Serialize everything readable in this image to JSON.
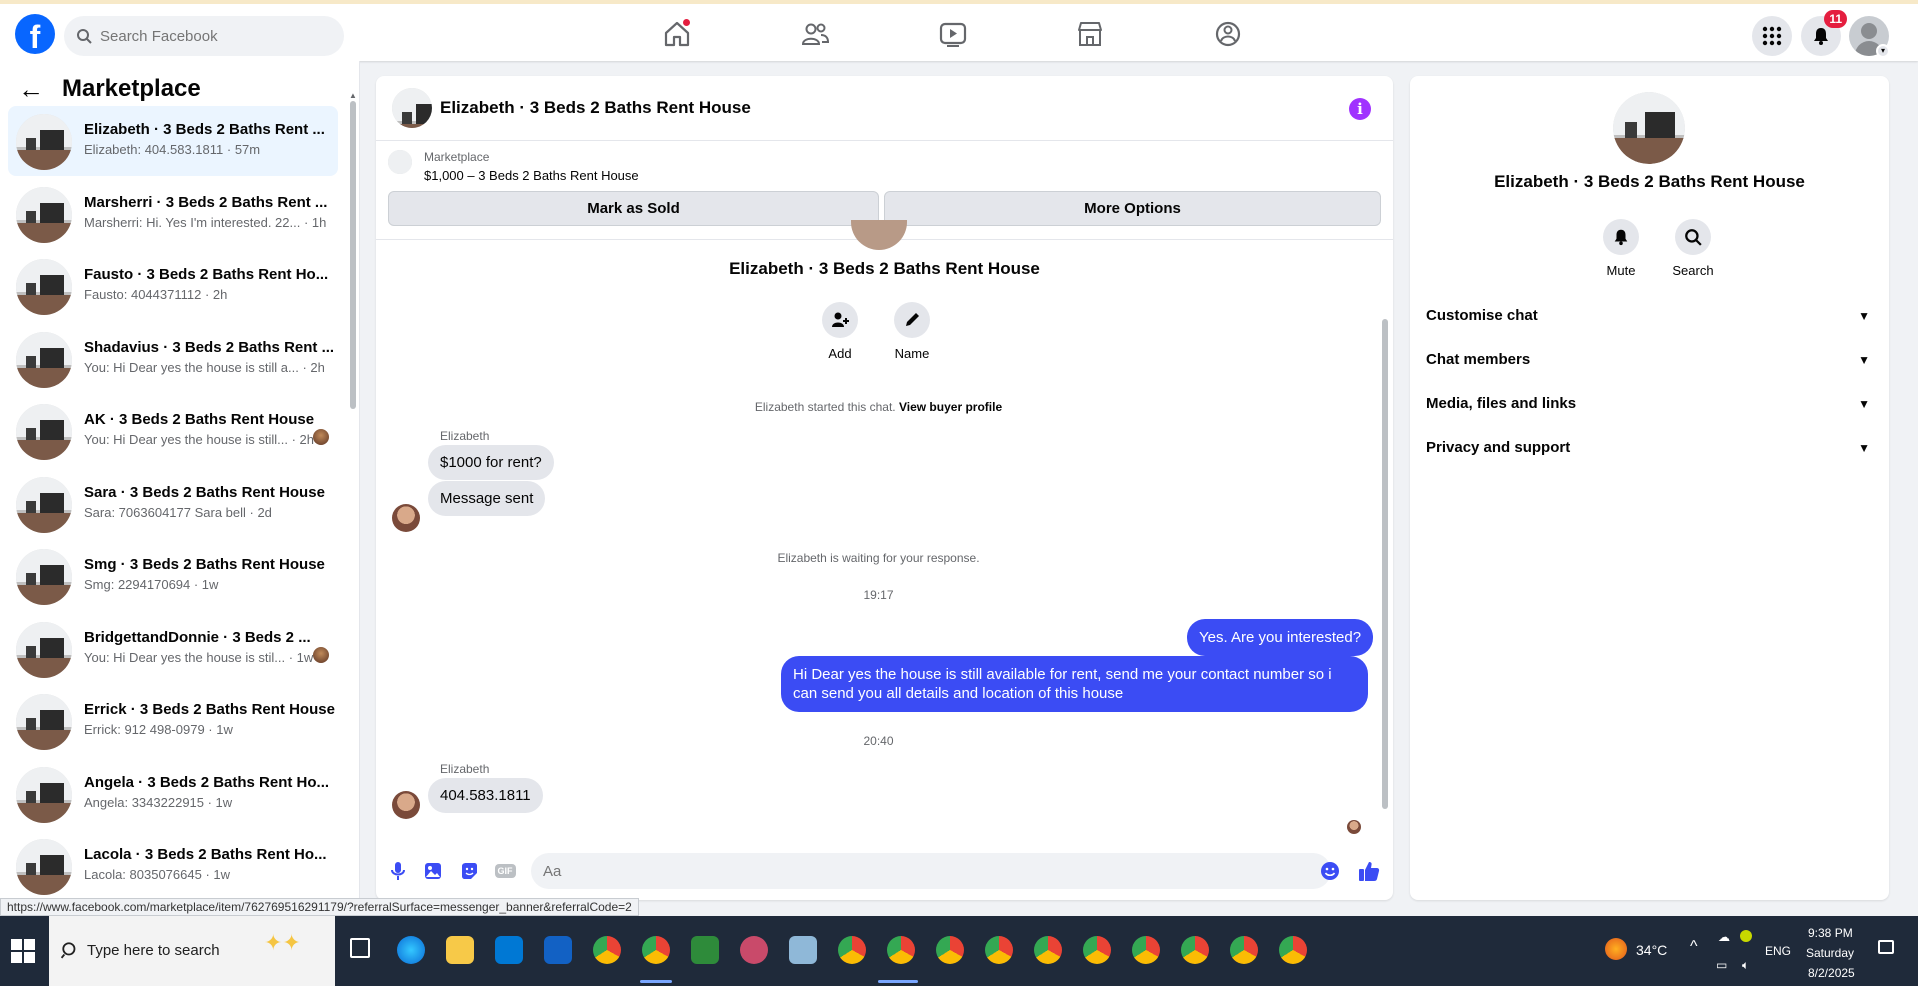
{
  "topbar": {
    "search_placeholder": "Search Facebook",
    "notif_count": "11",
    "logo_letter": "f"
  },
  "sidebar": {
    "title": "Marketplace",
    "conversations": [
      {
        "title": "Elizabeth · 3 Beds 2 Baths Rent ...",
        "preview": "Elizabeth: 404.583.1811 · 57m"
      },
      {
        "title": "Marsherri · 3 Beds 2 Baths Rent ...",
        "preview": "Marsherri: Hi. Yes I'm interested. 22... · 1h"
      },
      {
        "title": "Fausto · 3 Beds 2 Baths Rent Ho...",
        "preview": "Fausto: 4044371112 · 2h"
      },
      {
        "title": "Shadavius · 3 Beds 2 Baths Rent ...",
        "preview": "You: Hi Dear yes the house is still a... · 2h"
      },
      {
        "title": "AK · 3 Beds 2 Baths Rent House",
        "preview": "You: Hi Dear yes the house is still... · 2h"
      },
      {
        "title": "Sara · 3 Beds 2 Baths Rent House",
        "preview": "Sara: 7063604177 Sara bell · 2d"
      },
      {
        "title": "Smg · 3 Beds 2 Baths Rent House",
        "preview": "Smg: 2294170694 · 1w"
      },
      {
        "title": "BridgettandDonnie · 3 Beds 2 ...",
        "preview": "You: Hi Dear yes the house is stil... · 1w"
      },
      {
        "title": "Errick · 3 Beds 2 Baths Rent House",
        "preview": "Errick: 912 498-0979 · 1w"
      },
      {
        "title": "Angela · 3 Beds 2 Baths Rent Ho...",
        "preview": "Angela: 3343222915 · 1w"
      },
      {
        "title": "Lacola · 3 Beds 2 Baths Rent Ho...",
        "preview": "Lacola: 8035076645 · 1w"
      }
    ]
  },
  "chat": {
    "title": "Elizabeth · 3 Beds 2 Baths Rent House",
    "banner_label": "Marketplace",
    "banner_item": "$1,000 – 3 Beds 2 Baths Rent House",
    "mark_sold": "Mark as Sold",
    "more_options": "More Options",
    "chat_name": "Elizabeth · 3 Beds 2 Baths Rent House",
    "add_label": "Add",
    "name_label": "Name",
    "started_text": "Elizabeth started this chat.",
    "view_profile": "View buyer profile",
    "sender1": "Elizabeth",
    "msg1": "$1000 for rent?",
    "msg2": "Message sent",
    "waiting": "Elizabeth is waiting for your response.",
    "time1": "19:17",
    "out1": "Yes. Are you interested?",
    "out2": "Hi Dear yes the house is still available for rent, send me your contact number so i can send you all details and location of this house",
    "time2": "20:40",
    "sender2": "Elizabeth",
    "msg3": "404.583.1811",
    "composer_placeholder": "Aa",
    "gif_label": "GIF"
  },
  "rpanel": {
    "title": "Elizabeth · 3 Beds 2 Baths Rent House",
    "mute": "Mute",
    "search": "Search",
    "rows": [
      "Customise chat",
      "Chat members",
      "Media, files and links",
      "Privacy and support"
    ]
  },
  "status_url": "https://www.facebook.com/marketplace/item/762769516291179/?referralSurface=messenger_banner&referralCode=2",
  "taskbar": {
    "search_placeholder": "Type here to search",
    "temp": "34°C",
    "lang": "ENG",
    "time": "9:38 PM",
    "day": "Saturday",
    "date": "8/2/2025"
  },
  "colors": {
    "brand": "#0866ff",
    "outgoing": "#3b4cf4",
    "info": "#a033ff",
    "badge": "#e41e3f"
  }
}
